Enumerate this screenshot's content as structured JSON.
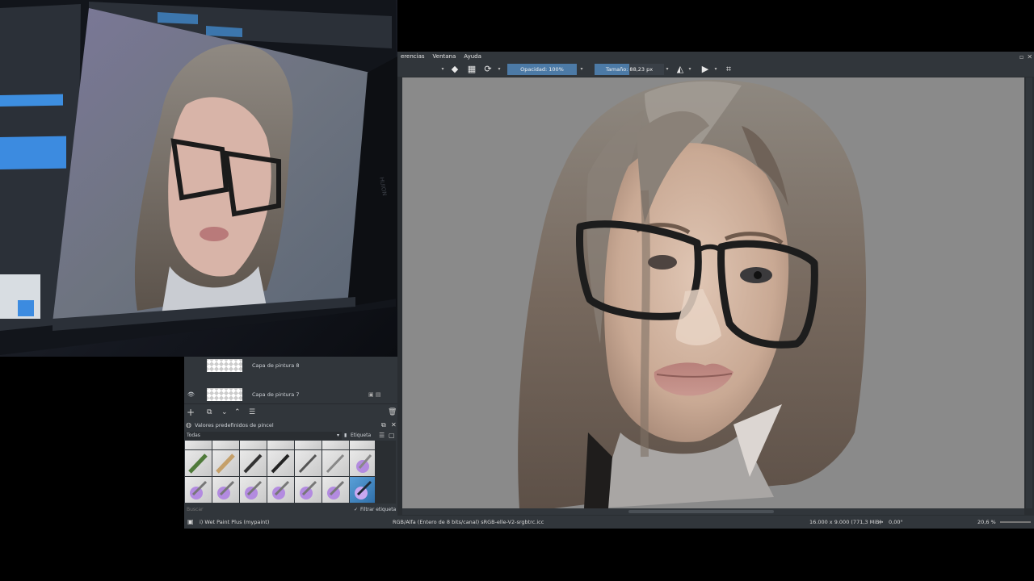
{
  "menu": {
    "items": [
      "erencias",
      "Ventana",
      "Ayuda"
    ]
  },
  "toolbar": {
    "opacity_label": "Opacidad: 100%",
    "size_label": "Tamaño: 88,23 px",
    "opacity_value": 1.0,
    "size_fill": 0.5
  },
  "layers": {
    "rows": [
      {
        "name": "Capa de pintura 8"
      },
      {
        "name": "Capa de pintura 7"
      }
    ]
  },
  "brush_presets": {
    "title": "Valores predefinidos de pincel",
    "filter_value": "Todas",
    "tag_label": "Etiqueta",
    "search_placeholder": "Buscar",
    "filter_tag_label": "Filtrar etiqueta"
  },
  "status": {
    "brush_name": "i) Wet Paint Plus (mypaint)",
    "color_space": "RGB/Alfa (Entero de 8 bits/canal)  sRGB-elle-V2-srgbtrc.icc",
    "dimensions": "16.000 x 9.000 (771,3 MiB)",
    "rotation": "0,00°",
    "zoom": "20,6 %"
  },
  "colors": {
    "panel_bg": "#31363b",
    "accent": "#4c7aa6",
    "canvas_bg": "#8a8a8a"
  },
  "photo": {
    "screen_brand": "HUION"
  }
}
